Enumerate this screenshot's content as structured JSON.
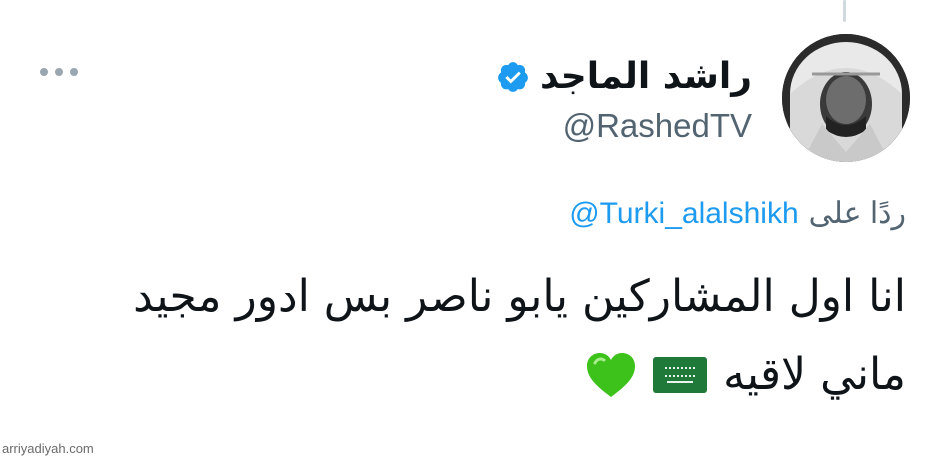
{
  "tweet": {
    "author_name": "راشد الماجد",
    "handle": "@RashedTV",
    "verified": true,
    "reply_prefix": "ردًا على",
    "reply_to": "@Turki_alalshikh",
    "text_line1": "انا اول المشاركين يابو ناصر بس ادور مجيد",
    "text_line2": "ماني لاقيه",
    "emojis": [
      "saudi-flag-icon",
      "green-heart-icon"
    ]
  },
  "watermark": "arriyadiyah.com",
  "colors": {
    "link": "#1d9bf0",
    "muted": "#536471",
    "text": "#0f1419",
    "verified": "#1d9bf0",
    "flag_green": "#1f7a3a",
    "heart_green": "#3cc21a"
  }
}
